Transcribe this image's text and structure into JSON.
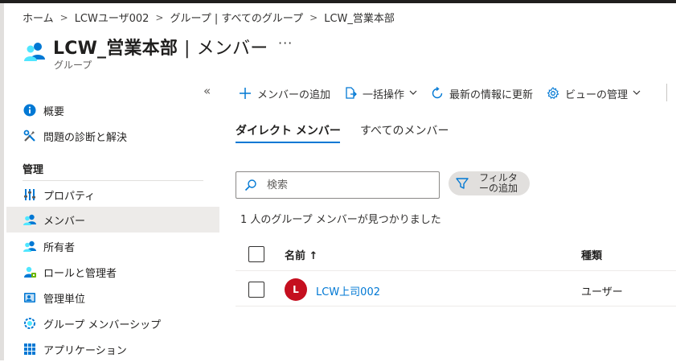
{
  "breadcrumb": {
    "items": [
      "ホーム",
      "LCWユーザ002",
      "グループ | すべてのグループ",
      "LCW_営業本部"
    ],
    "separator": ">"
  },
  "header": {
    "title": "LCW_営業本部",
    "title_separator": "|",
    "title_section": "メンバー",
    "subtitle": "グループ",
    "more_label": "···",
    "icon": "group-people-icon"
  },
  "sidebar": {
    "collapse_label": "«",
    "items_top": [
      {
        "label": "概要",
        "icon": "info-icon"
      },
      {
        "label": "問題の診断と解決",
        "icon": "tools-icon"
      }
    ],
    "section_title": "管理",
    "items_manage": [
      {
        "label": "プロパティ",
        "icon": "properties-icon"
      },
      {
        "label": "メンバー",
        "icon": "members-icon",
        "active": true
      },
      {
        "label": "所有者",
        "icon": "owners-icon"
      },
      {
        "label": "ロールと管理者",
        "icon": "roles-icon"
      },
      {
        "label": "管理単位",
        "icon": "admin-units-icon"
      },
      {
        "label": "グループ メンバーシップ",
        "icon": "group-membership-icon"
      },
      {
        "label": "アプリケーション",
        "icon": "applications-icon"
      }
    ]
  },
  "toolbar": {
    "add_member": "メンバーの追加",
    "bulk_ops": "一括操作",
    "refresh": "最新の情報に更新",
    "manage_view": "ビューの管理"
  },
  "tabs": [
    {
      "label": "ダイレクト メンバー",
      "active": true
    },
    {
      "label": "すべてのメンバー",
      "active": false
    }
  ],
  "search": {
    "placeholder": "検索",
    "value": ""
  },
  "filter": {
    "label": "フィルターの追加",
    "line1": "フィルタ",
    "line2": "ーの追加"
  },
  "result_count": "1 人のグループ メンバーが見つかりました",
  "table": {
    "columns": [
      "名前 ↑",
      "種類"
    ],
    "rows": [
      {
        "avatar_initial": "L",
        "name": "LCW上司002",
        "type": "ユーザー"
      }
    ]
  },
  "colors": {
    "accent": "#0078d4",
    "avatar": "#c50f1f",
    "active_nav": "#edebe9"
  }
}
